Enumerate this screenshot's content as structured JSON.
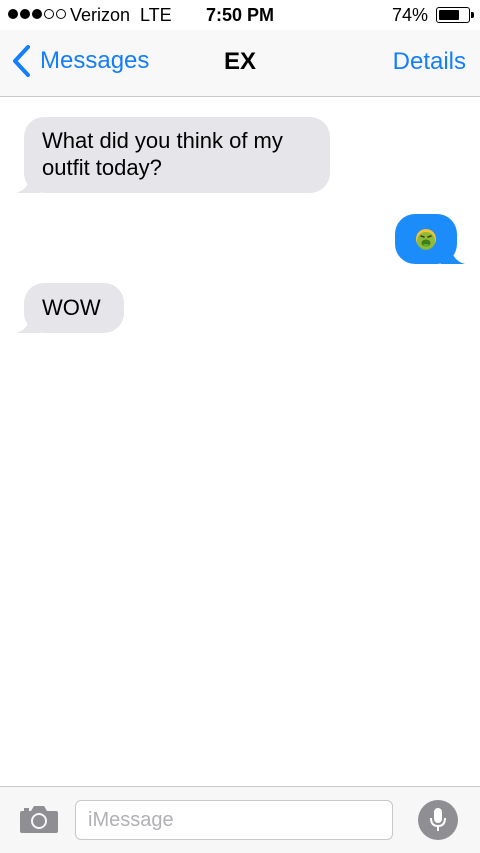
{
  "status_bar": {
    "signal_bars_filled": 3,
    "signal_bars_total": 5,
    "carrier": "Verizon",
    "network": "LTE",
    "time": "7:50 PM",
    "battery_percent": "74%",
    "battery_level": 0.74
  },
  "nav": {
    "back_label": "Messages",
    "title": "EX",
    "details_label": "Details",
    "accent_color": "#147efb"
  },
  "messages": [
    {
      "direction": "incoming",
      "text": "What did you think of my outfit today?"
    },
    {
      "direction": "outgoing",
      "text": "🤮",
      "icon": "nauseated-face-emoji"
    },
    {
      "direction": "incoming",
      "text": "WOW"
    }
  ],
  "input": {
    "placeholder": "iMessage",
    "value": "",
    "camera_icon": "camera-icon",
    "mic_icon": "microphone-icon"
  },
  "colors": {
    "incoming_bubble": "#e5e5ea",
    "outgoing_bubble": "#1b8cfa"
  }
}
